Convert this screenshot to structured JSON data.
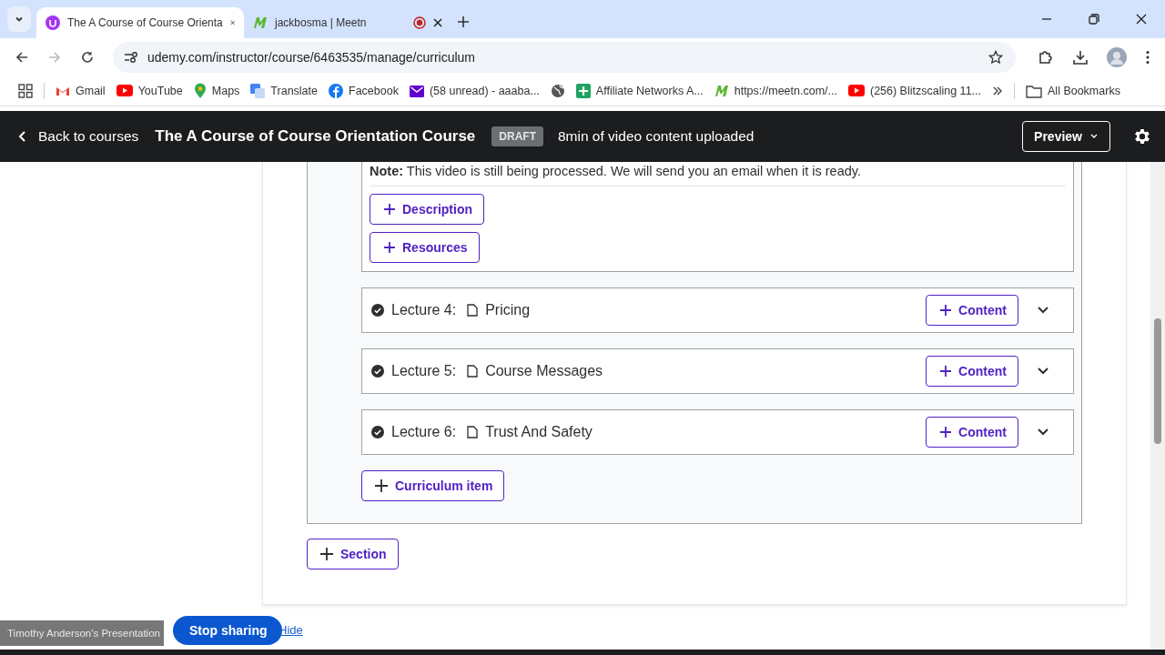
{
  "browser": {
    "tabs": [
      {
        "title": "The A Course of Course Orienta",
        "selected": true,
        "kind": "udemy",
        "recording": false
      },
      {
        "title": "jackbosma | Meetn",
        "selected": false,
        "kind": "meetn",
        "recording": true
      }
    ],
    "url": "udemy.com/instructor/course/6463535/manage/curriculum",
    "bookmarks": [
      {
        "label": "Gmail",
        "kind": "gmail"
      },
      {
        "label": "YouTube",
        "kind": "youtube"
      },
      {
        "label": "Maps",
        "kind": "maps"
      },
      {
        "label": "Translate",
        "kind": "translate"
      },
      {
        "label": "Facebook",
        "kind": "facebook"
      },
      {
        "label": "(58 unread) - aaaba...",
        "kind": "mail"
      },
      {
        "kind": "globe"
      },
      {
        "label": "Affiliate Networks A...",
        "kind": "sheets"
      },
      {
        "label": "https://meetn.com/...",
        "kind": "meetn"
      },
      {
        "label": "(256) Blitzscaling 11...",
        "kind": "youtube"
      }
    ],
    "all_bookmarks": "All Bookmarks"
  },
  "header": {
    "back": "Back to courses",
    "title": "The A Course of Course Orientation Course",
    "status": "DRAFT",
    "info": "8min of video content uploaded",
    "preview": "Preview"
  },
  "open_lecture": {
    "note": "**Note:** This video is still being processed. We will send you an email when it is ready.",
    "buttons": [
      "Description",
      "Resources"
    ]
  },
  "lectures": [
    {
      "label": "Lecture 4:",
      "title": "Pricing",
      "complete": true,
      "button": "Content"
    },
    {
      "label": "Lecture 5:",
      "title": "Course Messages",
      "complete": true,
      "button": "Content"
    },
    {
      "label": "Lecture 6:",
      "title": "Trust And Safety",
      "complete": true,
      "button": "Content"
    }
  ],
  "curriculum_button": "Curriculum item",
  "section_button": "Section",
  "sharing_bar": {
    "presenter": "Timothy Anderson's Presentation",
    "stop": "Stop sharing",
    "hide": "Hide"
  }
}
